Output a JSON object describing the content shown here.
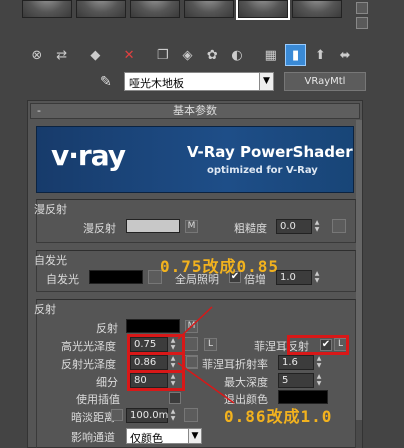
{
  "material": {
    "name": "哑光木地板",
    "type_button": "VRayMtl"
  },
  "rollout": {
    "title": "基本参数",
    "collapse_symbol": "-"
  },
  "banner": {
    "logo": "v·ray",
    "title": "V-Ray PowerShader",
    "subtitle": "optimized for V-Ray"
  },
  "diffuse": {
    "group_title": "漫反射",
    "diffuse_label": "漫反射",
    "diffuse_color": "#c8c8c8",
    "map_button": "M",
    "roughness_label": "粗糙度",
    "roughness_value": "0.0"
  },
  "selfillum": {
    "group_title": "自发光",
    "label": "自发光",
    "color": "#000000",
    "gi_label": "全局照明",
    "gi_checked": "✔",
    "mult_label": "倍增",
    "mult_value": "1.0"
  },
  "reflection": {
    "group_title": "反射",
    "reflect_label": "反射",
    "reflect_map_button": "M",
    "hilight_gloss_label": "高光光泽度",
    "hilight_gloss_value": "0.75",
    "lock_button": "L",
    "fresnel_label": "菲涅耳反射",
    "fresnel_checked": "✔",
    "fresnel_lock": "L",
    "refl_gloss_label": "反射光泽度",
    "refl_gloss_value": "0.86",
    "fresnel_ior_label": "菲涅耳折射率",
    "fresnel_ior_value": "1.6",
    "subdivs_label": "细分",
    "subdivs_value": "80",
    "max_depth_label": "最大深度",
    "max_depth_value": "5",
    "use_interp_label": "使用插值",
    "exit_color_label": "退出颜色",
    "exit_color": "#000000",
    "dim_distance_label": "暗淡距离",
    "dim_distance_value": "100.0m",
    "affect_channels_label": "影响通道",
    "affect_channels_value": "仅颜色"
  },
  "annotations": {
    "top": "0.75改成0.85",
    "bottom": "0.86改成1.0",
    "color": "#f2b21e"
  },
  "colors": {
    "highlight_box": "#d81818",
    "banner_bg": "#1e4e88",
    "active_tool": "#3a8ad6"
  }
}
